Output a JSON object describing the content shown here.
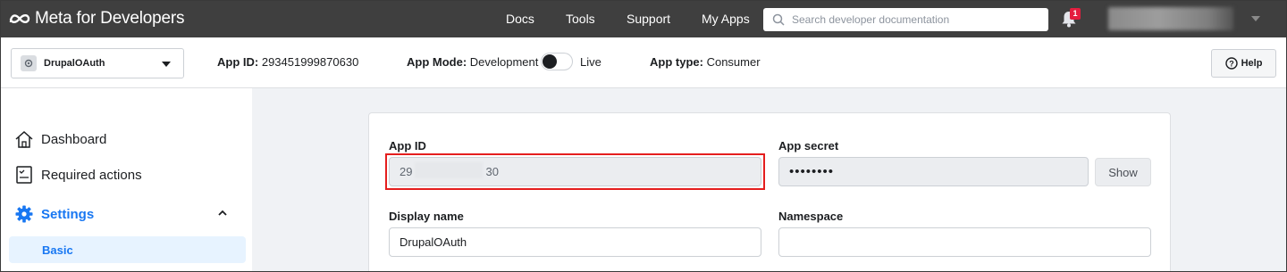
{
  "topbar": {
    "brand": "Meta for Developers",
    "nav": [
      "Docs",
      "Tools",
      "Support",
      "My Apps"
    ],
    "search_placeholder": "Search developer documentation",
    "notification_count": "1"
  },
  "appbar": {
    "app_name": "DrupalOAuth",
    "app_id_label": "App ID:",
    "app_id_value": "293451999870630",
    "app_mode_label": "App Mode:",
    "app_mode_value": "Development",
    "app_mode_live": "Live",
    "app_type_label": "App type:",
    "app_type_value": "Consumer",
    "help_label": "Help"
  },
  "sidebar": {
    "items": [
      {
        "label": "Dashboard",
        "icon": "home-icon"
      },
      {
        "label": "Required actions",
        "icon": "checklist-icon"
      },
      {
        "label": "Settings",
        "icon": "gear-icon"
      }
    ],
    "sub_items": [
      {
        "label": "Basic"
      }
    ]
  },
  "form": {
    "app_id_label": "App ID",
    "app_id_prefix": "29",
    "app_id_suffix": "30",
    "app_secret_label": "App secret",
    "app_secret_value": "••••••••",
    "show_label": "Show",
    "display_name_label": "Display name",
    "display_name_value": "DrupalOAuth",
    "namespace_label": "Namespace",
    "namespace_value": ""
  },
  "colors": {
    "topbar_bg": "#3f3f3f",
    "accent": "#1877f2",
    "highlight": "#e41e1e"
  }
}
